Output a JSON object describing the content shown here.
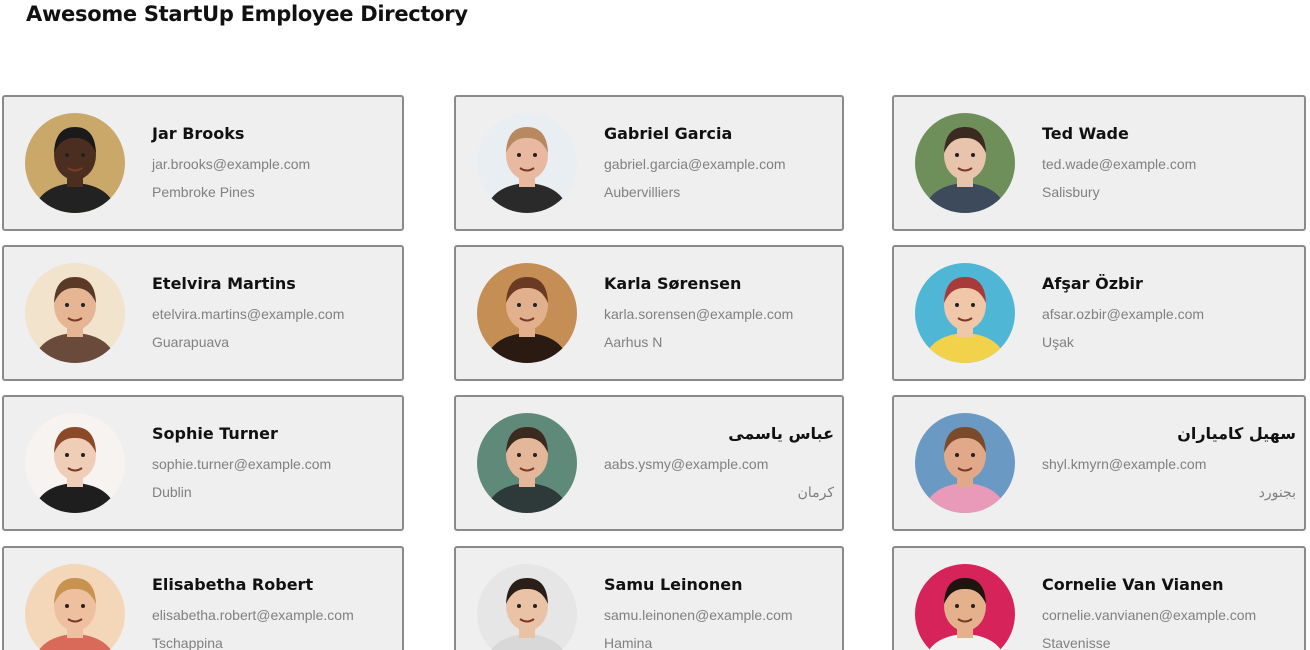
{
  "header": {
    "title": "Awesome StartUp Employee Directory"
  },
  "employees": [
    {
      "name": "Jar Brooks",
      "email": "jar.brooks@example.com",
      "city": "Pembroke Pines",
      "photo": {
        "bg": "#c9a86a",
        "skin": "#4b2e1f",
        "hair": "#1a1a1a",
        "shirt": "#222222"
      }
    },
    {
      "name": "Gabriel Garcia",
      "email": "gabriel.garcia@example.com",
      "city": "Aubervilliers",
      "photo": {
        "bg": "#e8eef2",
        "skin": "#e8b9a0",
        "hair": "#b88860",
        "shirt": "#2a2a2a"
      }
    },
    {
      "name": "Ted Wade",
      "email": "ted.wade@example.com",
      "city": "Salisbury",
      "photo": {
        "bg": "#6f8f5a",
        "skin": "#e9c4ad",
        "hair": "#3a2a20",
        "shirt": "#3c4a5c"
      }
    },
    {
      "name": "Etelvira Martins",
      "email": "etelvira.martins@example.com",
      "city": "Guarapuava",
      "photo": {
        "bg": "#f1e3cc",
        "skin": "#e6b594",
        "hair": "#5a3a26",
        "shirt": "#6a4a3a"
      }
    },
    {
      "name": "Karla Sørensen",
      "email": "karla.sorensen@example.com",
      "city": "Aarhus N",
      "photo": {
        "bg": "#c58e55",
        "skin": "#e2b08c",
        "hair": "#6b3a22",
        "shirt": "#2a1a12"
      }
    },
    {
      "name": "Afşar Özbir",
      "email": "afsar.ozbir@example.com",
      "city": "Uşak",
      "photo": {
        "bg": "#4fb6d6",
        "skin": "#f0c7a8",
        "hair": "#a83a3a",
        "shirt": "#f2d24a"
      }
    },
    {
      "name": "Sophie Turner",
      "email": "sophie.turner@example.com",
      "city": "Dublin",
      "photo": {
        "bg": "#f7f3f0",
        "skin": "#f0cdb6",
        "hair": "#8a4a2a",
        "shirt": "#1e1e1e"
      }
    },
    {
      "name": "عباس یاسمی",
      "email": "aabs.ysmy@example.com",
      "city": "کرمان",
      "photo": {
        "bg": "#5f8a7a",
        "skin": "#e5b79a",
        "hair": "#3a2a1f",
        "shirt": "#2e3a3a"
      }
    },
    {
      "name": "سهیل کامیاران",
      "email": "shyl.kmyrn@example.com",
      "city": "بجنورد",
      "photo": {
        "bg": "#6a9ac4",
        "skin": "#e2a88a",
        "hair": "#7a4a2a",
        "shirt": "#e89ab8"
      }
    },
    {
      "name": "Elisabetha Robert",
      "email": "elisabetha.robert@example.com",
      "city": "Tschappina",
      "photo": {
        "bg": "#f3d7b8",
        "skin": "#eec0a0",
        "hair": "#c8934f",
        "shirt": "#d96a5a"
      }
    },
    {
      "name": "Samu Leinonen",
      "email": "samu.leinonen@example.com",
      "city": "Hamina",
      "photo": {
        "bg": "#e6e6e6",
        "skin": "#eac3a6",
        "hair": "#2a1f18",
        "shirt": "#d8d8d8"
      }
    },
    {
      "name": "Cornelie Van Vianen",
      "email": "cornelie.vanvianen@example.com",
      "city": "Stavenisse",
      "photo": {
        "bg": "#d6245a",
        "skin": "#e5b08c",
        "hair": "#1e1410",
        "shirt": "#f2f2f2"
      }
    }
  ]
}
